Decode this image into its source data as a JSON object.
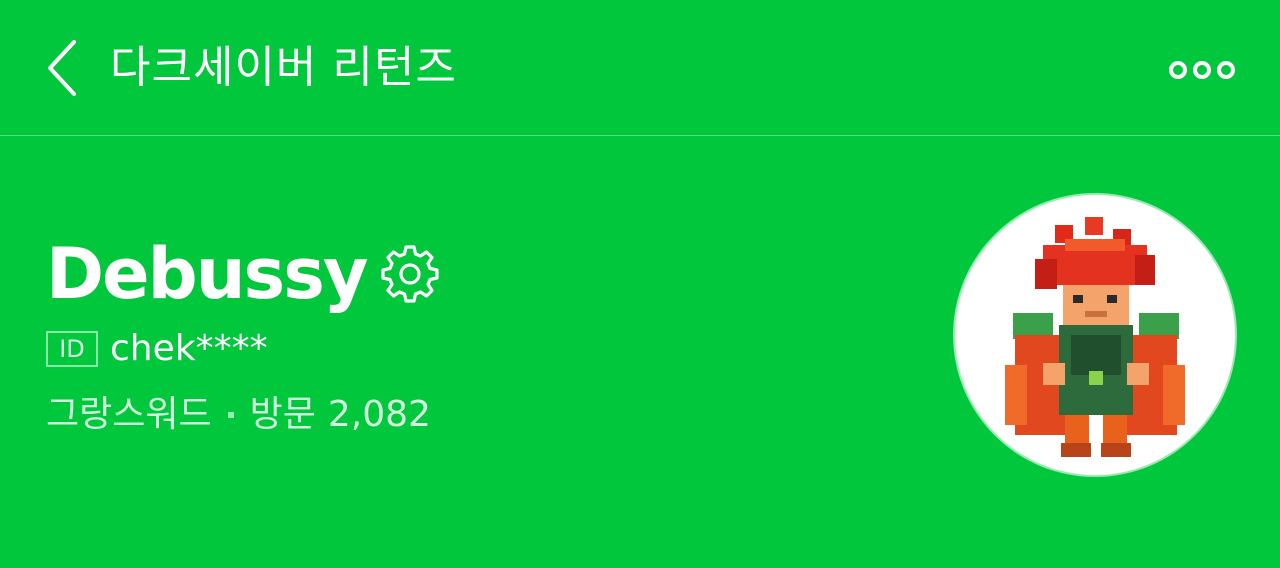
{
  "header": {
    "title": "다크세이버 리턴즈",
    "back_icon": "chevron-left-icon",
    "more_icon": "more-dots-icon"
  },
  "profile": {
    "nickname": "Debussy",
    "settings_icon": "gear-icon",
    "id_badge": "ID",
    "id_value": "chek****",
    "grade": "그랑스워드",
    "visit_label": "방문",
    "visit_count": "2,082",
    "avatar": "pixel-art character avatar"
  },
  "colors": {
    "background": "#00c73c",
    "text": "#ffffff"
  }
}
